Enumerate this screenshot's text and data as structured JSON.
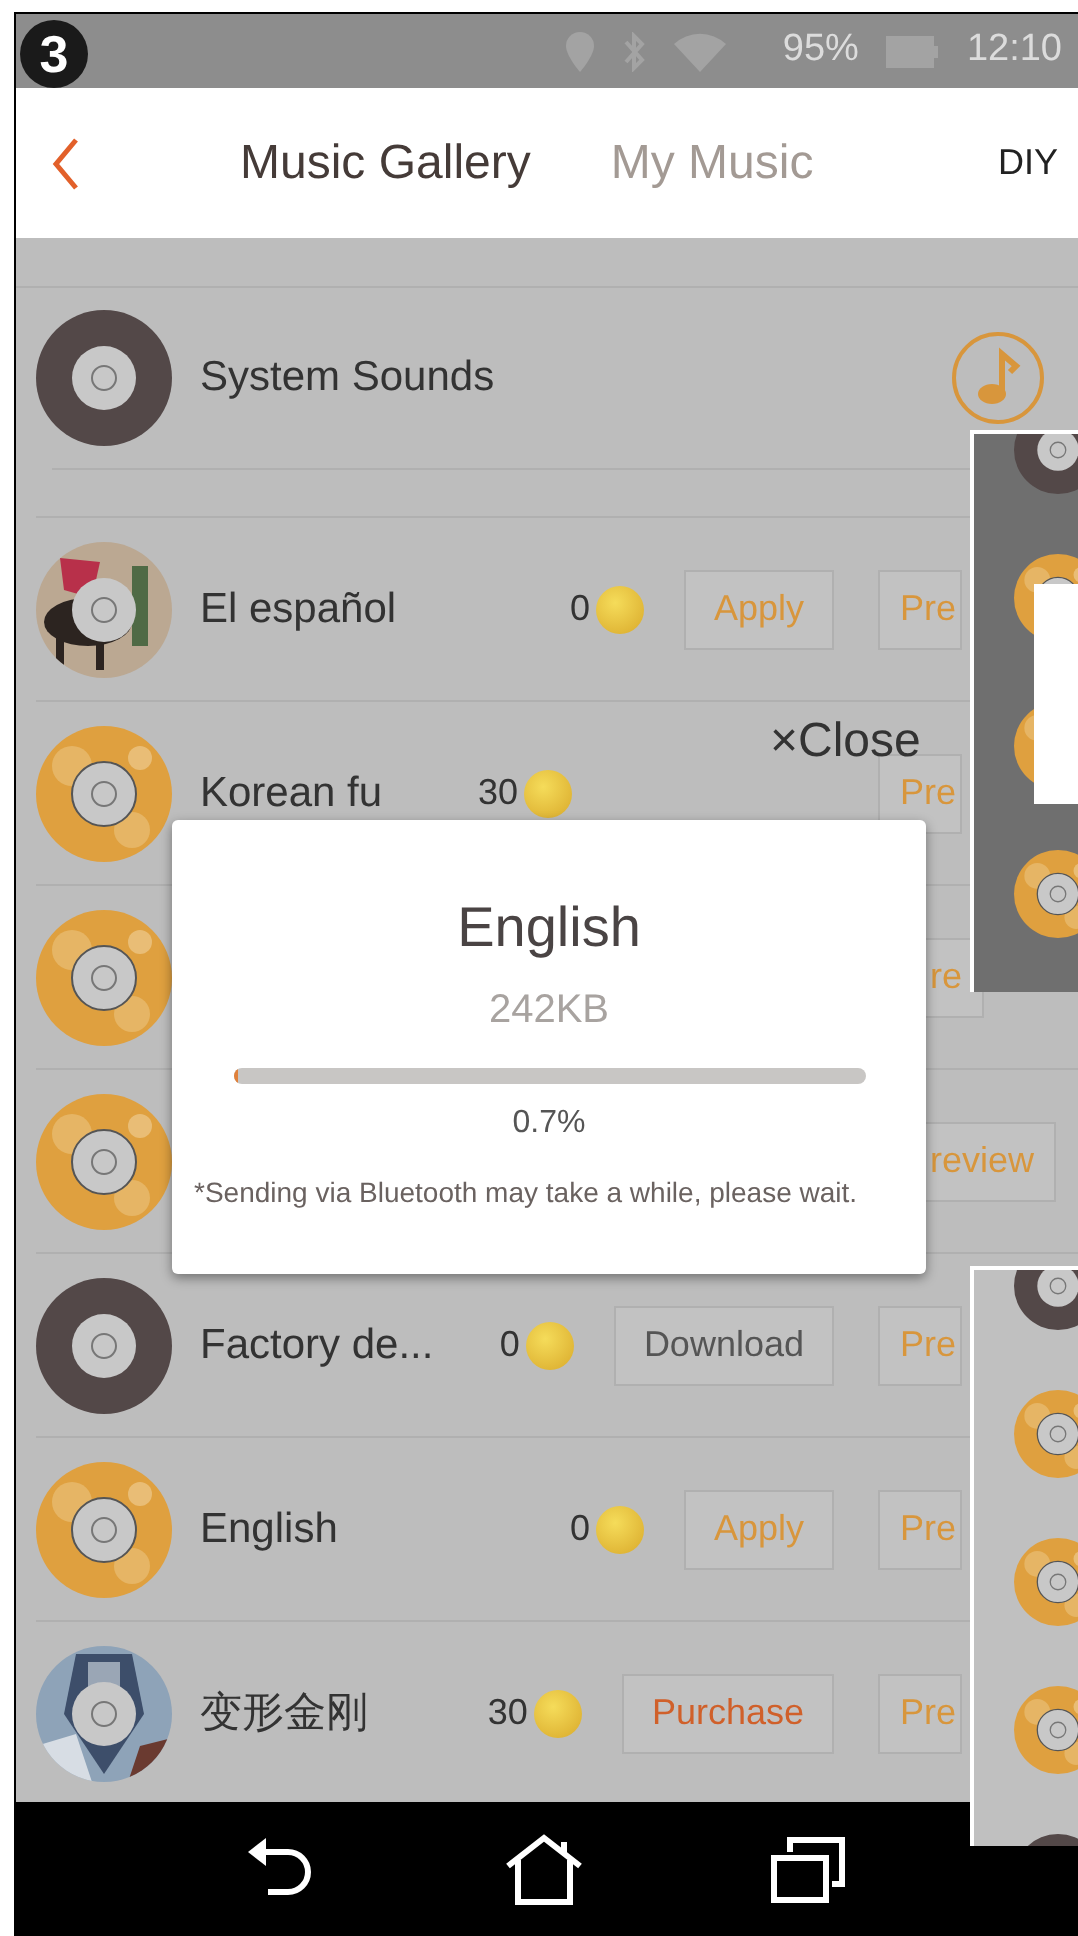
{
  "badge": "3",
  "status_bar": {
    "battery": "95%",
    "time": "12:10"
  },
  "header": {
    "tabs": [
      {
        "label": "Music Gallery",
        "selected": true
      },
      {
        "label": "My Music",
        "selected": false
      }
    ],
    "diy": "DIY"
  },
  "system_row": {
    "name": "System Sounds"
  },
  "rows": [
    {
      "kind": "picture",
      "name": "El español",
      "coins": "0",
      "action": {
        "kind": "apply",
        "label": "Apply"
      },
      "preview": "Pre"
    },
    {
      "kind": "orange",
      "name": "Korean fu",
      "coins": "30",
      "preview": "Pre"
    },
    {
      "kind": "orange",
      "preview": "re"
    },
    {
      "kind": "orange",
      "preview": "review"
    },
    {
      "kind": "dark",
      "name": "Factory de...",
      "coins": "0",
      "action": {
        "kind": "download",
        "label": "Download"
      },
      "preview": "Pre"
    },
    {
      "kind": "orange",
      "name": "English",
      "coins": "0",
      "action": {
        "kind": "apply",
        "label": "Apply"
      },
      "preview": "Pre"
    },
    {
      "kind": "picture",
      "name": "变形金刚",
      "coins": "30",
      "action": {
        "kind": "purchase",
        "label": "Purchase"
      },
      "preview": "Pre"
    }
  ],
  "dialog": {
    "close": "×Close",
    "title": "English",
    "size": "242KB",
    "level": 0.007,
    "percent": "0.7%",
    "note": "*Sending via Bluetooth may take a while, please wait."
  }
}
